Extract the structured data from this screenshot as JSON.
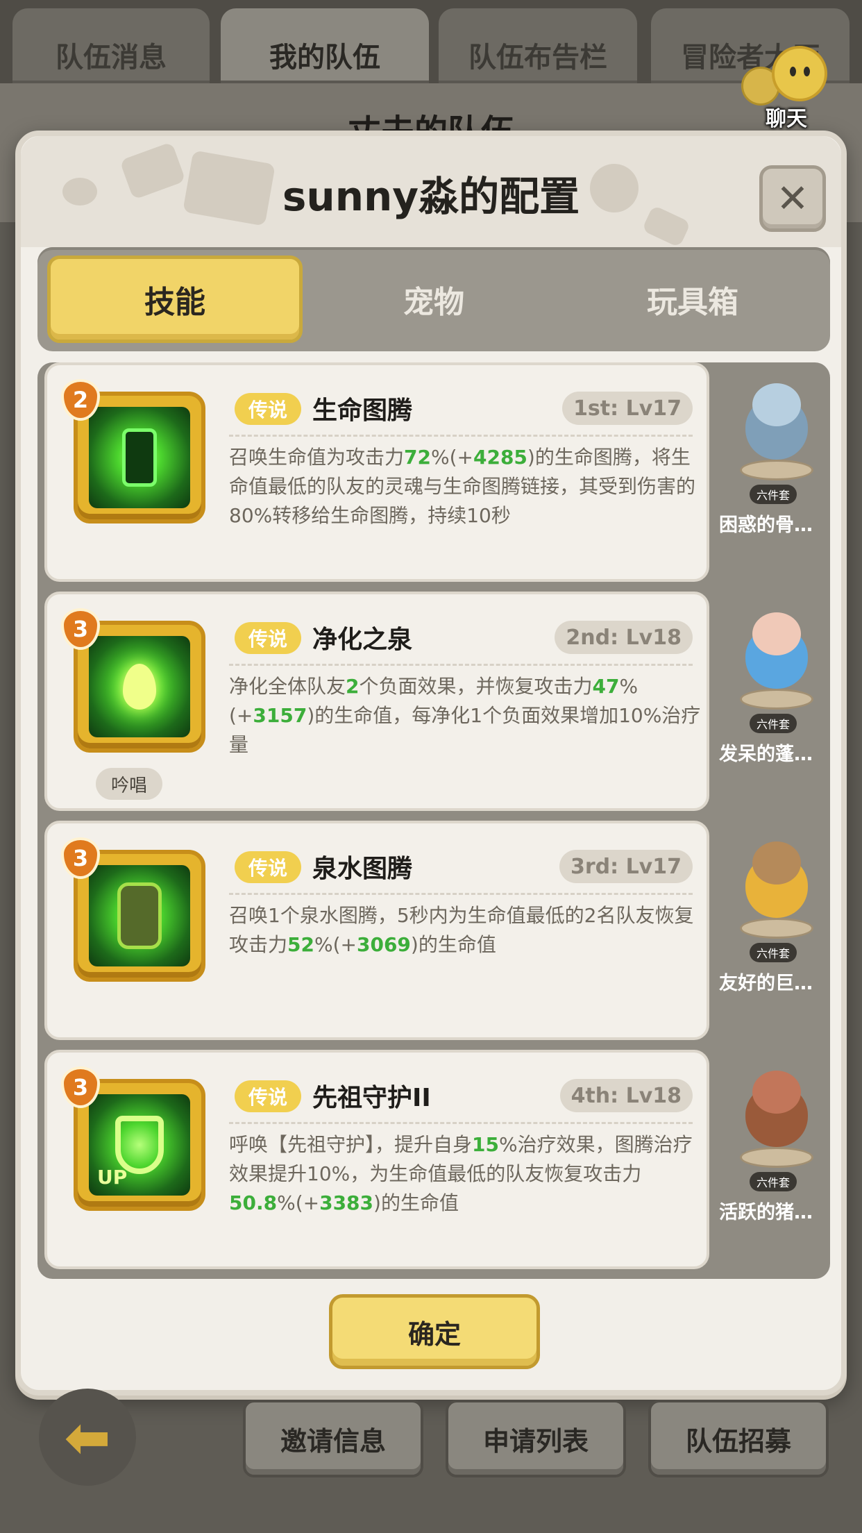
{
  "top_tabs": [
    "队伍消息",
    "我的队伍",
    "队伍布告栏",
    "冒险者大厅"
  ],
  "background_title": "丈夫的队伍",
  "chat": {
    "label": "聊天",
    "icon": "chat-bubble-icon"
  },
  "modal": {
    "title": "sunny淼的配置",
    "close_icon": "close-icon",
    "tabs": [
      "技能",
      "宠物",
      "玩具箱"
    ],
    "skills": [
      {
        "badge": "2",
        "rarity": "传说",
        "name": "生命图腾",
        "slot": "1st: Lv17",
        "desc": [
          {
            "t": "召唤生命值为攻击力"
          },
          {
            "t": "72",
            "hl": true
          },
          {
            "t": "%(+"
          },
          {
            "t": "4285",
            "hl": true
          },
          {
            "t": ")的生命图腾，将生命值最低的队友的灵魂与生命图腾链接，其受到伤害的80%转移给生命图腾，持续10秒"
          }
        ],
        "chant": "",
        "pet": {
          "name": "困惑的骨…",
          "set": "六件套"
        }
      },
      {
        "badge": "3",
        "rarity": "传说",
        "name": "净化之泉",
        "slot": "2nd: Lv18",
        "desc": [
          {
            "t": "净化全体队友"
          },
          {
            "t": "2",
            "hl": true
          },
          {
            "t": "个负面效果，并恢复攻击力"
          },
          {
            "t": "47",
            "hl": true
          },
          {
            "t": "%(+"
          },
          {
            "t": "3157",
            "hl": true
          },
          {
            "t": ")的生命值，每净化1个负面效果增加10%治疗量"
          }
        ],
        "chant": "吟唱",
        "pet": {
          "name": "发呆的蓬…",
          "set": "六件套"
        }
      },
      {
        "badge": "3",
        "rarity": "传说",
        "name": "泉水图腾",
        "slot": "3rd: Lv17",
        "desc": [
          {
            "t": "召唤1个泉水图腾，5秒内为生命值最低的2名队友恢复攻击力"
          },
          {
            "t": "52",
            "hl": true
          },
          {
            "t": "%(+"
          },
          {
            "t": "3069",
            "hl": true
          },
          {
            "t": ")的生命值"
          }
        ],
        "chant": "",
        "pet": {
          "name": "友好的巨…",
          "set": "六件套"
        }
      },
      {
        "badge": "3",
        "rarity": "传说",
        "name": "先祖守护II",
        "slot": "4th: Lv18",
        "desc": [
          {
            "t": "呼唤【先祖守护】，提升自身"
          },
          {
            "t": "15",
            "hl": true
          },
          {
            "t": "%治疗效果，图腾治疗效果提升10%，为生命值最低的队友恢复攻击力"
          },
          {
            "t": "50.8",
            "hl": true
          },
          {
            "t": "%(+"
          },
          {
            "t": "3383",
            "hl": true
          },
          {
            "t": ")的生命值"
          }
        ],
        "chant": "",
        "up_label": "UP",
        "pet": {
          "name": "活跃的猪…",
          "set": "六件套"
        }
      }
    ],
    "confirm_label": "确定"
  },
  "bottom_buttons": [
    "邀请信息",
    "申请列表",
    "队伍招募"
  ],
  "colors": {
    "accent_yellow": "#f1d468",
    "highlight_green": "#3cae3a",
    "badge_orange": "#e07a1e"
  }
}
